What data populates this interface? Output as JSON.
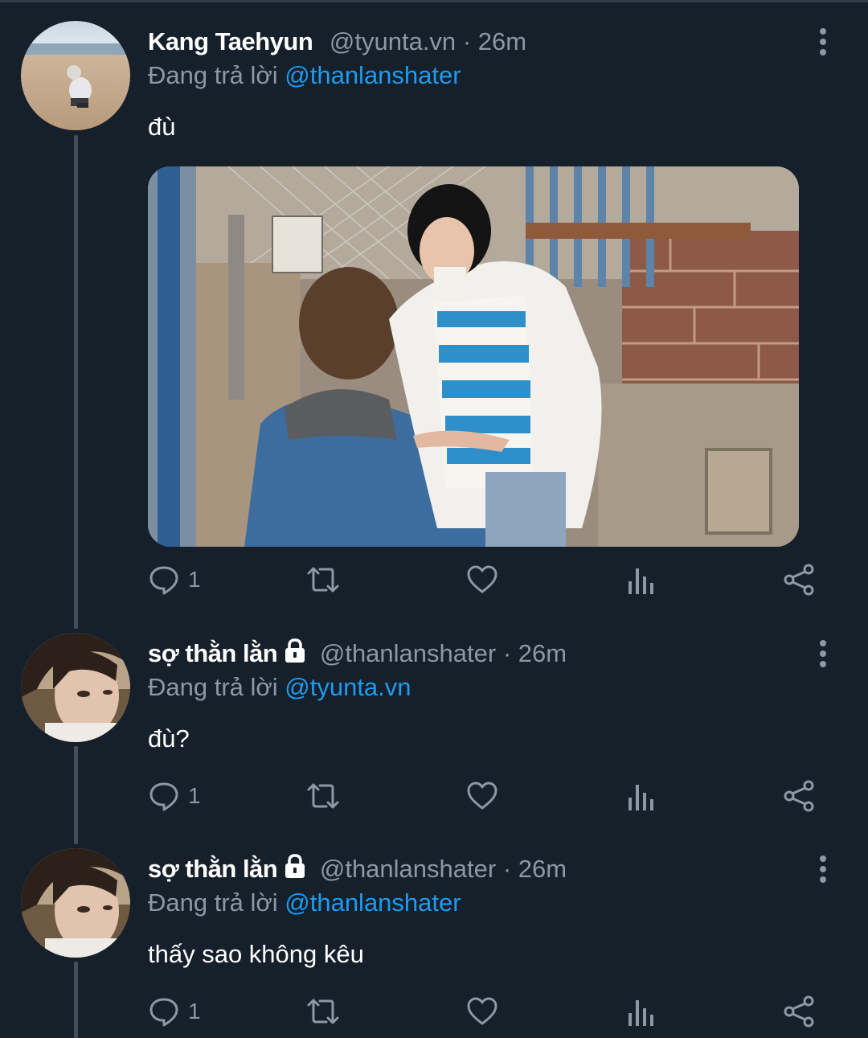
{
  "tweets": [
    {
      "name": "Kang Taehyun",
      "handle": "@tyunta.vn",
      "separator": "·",
      "time": "26m",
      "locked": false,
      "reply_prefix": "Đang trả lời",
      "reply_to": "@thanlanshater",
      "text": "đù",
      "reply_count": "1",
      "has_media": true
    },
    {
      "name": "sợ thằn lằn",
      "handle": "@thanlanshater",
      "separator": "·",
      "time": "26m",
      "locked": true,
      "reply_prefix": "Đang trả lời",
      "reply_to": "@tyunta.vn",
      "text": "đù?",
      "reply_count": "1",
      "has_media": false
    },
    {
      "name": "sợ thằn lằn",
      "handle": "@thanlanshater",
      "separator": "·",
      "time": "26m",
      "locked": true,
      "reply_prefix": "Đang trả lời",
      "reply_to": "@thanlanshater",
      "text": "thấy sao không kêu",
      "reply_count": "1",
      "has_media": false
    }
  ],
  "icons": {
    "reply": "reply-icon",
    "retweet": "retweet-icon",
    "like": "heart-icon",
    "views": "views-icon",
    "share": "share-icon",
    "more": "more-vertical-icon",
    "lock": "lock-icon"
  },
  "colors": {
    "background": "#15202b",
    "text": "#ffffff",
    "muted": "#8b98a5",
    "link": "#1d9bf0",
    "thread_line": "#42505e"
  }
}
